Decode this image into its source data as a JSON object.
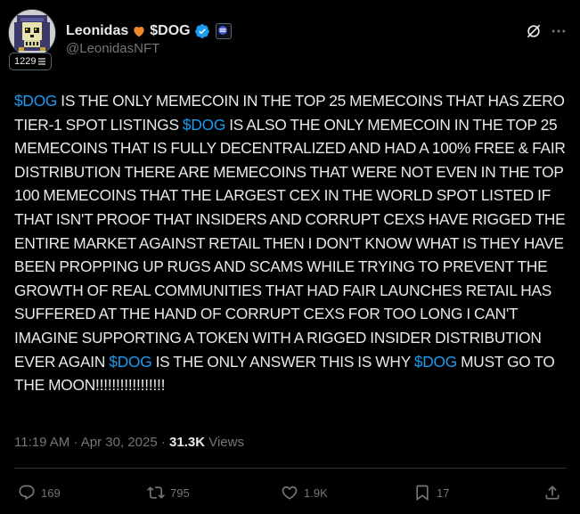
{
  "author": {
    "display_name": "Leonidas",
    "name_suffix": "$DOG",
    "handle": "@LeonidasNFT",
    "level_badge": "1229",
    "heart_icon": "orange-heart-icon",
    "verified_icon": "blue-verified-check-icon",
    "affiliate_icon": "affiliate-badge-icon",
    "avatar": "pixel-skull-hooded-avatar"
  },
  "header_actions": {
    "grok_icon": "grok-icon",
    "more_icon": "more-horizontal-icon"
  },
  "tweet": {
    "segments": [
      {
        "text": "$DOG",
        "type": "cashtag"
      },
      {
        "text": " IS THE ONLY MEMECOIN IN THE TOP 25 MEMECOINS THAT HAS ZERO TIER-1 SPOT LISTINGS ",
        "type": "text"
      },
      {
        "text": "$DOG",
        "type": "cashtag"
      },
      {
        "text": " IS ALSO THE ONLY MEMECOIN IN THE TOP 25 MEMECOINS THAT IS FULLY DECENTRALIZED AND HAD A 100% FREE & FAIR DISTRIBUTION THERE ARE MEMECOINS THAT WERE NOT EVEN IN THE TOP 100 MEMECOINS THAT THE LARGEST CEX IN THE WORLD SPOT LISTED IF THAT ISN'T PROOF THAT INSIDERS AND CORRUPT CEXS HAVE RIGGED THE ENTIRE MARKET AGAINST RETAIL THEN I DON'T KNOW WHAT IS THEY HAVE BEEN PROPPING UP RUGS AND SCAMS WHILE TRYING TO PREVENT THE GROWTH OF REAL COMMUNITIES THAT HAD FAIR LAUNCHES RETAIL HAS SUFFERED AT THE HAND OF CORRUPT CEXS FOR TOO LONG I CAN'T IMAGINE SUPPORTING A TOKEN WITH A RIGGED INSIDER DISTRIBUTION EVER AGAIN ",
        "type": "text"
      },
      {
        "text": "$DOG",
        "type": "cashtag"
      },
      {
        "text": " IS THE ONLY ANSWER THIS IS WHY ",
        "type": "text"
      },
      {
        "text": "$DOG",
        "type": "cashtag"
      },
      {
        "text": " MUST GO TO THE MOON!!!!!!!!!!!!!!!!!",
        "type": "text"
      }
    ]
  },
  "meta": {
    "time": "11:19 AM",
    "separator": "·",
    "date": "Apr 30, 2025",
    "views_count": "31.3K",
    "views_label": "Views"
  },
  "actions": {
    "replies": "169",
    "reposts": "795",
    "likes": "1.9K",
    "bookmarks": "17"
  },
  "colors": {
    "background": "#000000",
    "text": "#e7e9ea",
    "muted": "#71767b",
    "cashtag": "#1d9bf0",
    "heart": "#f4892b",
    "verified": "#1d9bf0"
  }
}
